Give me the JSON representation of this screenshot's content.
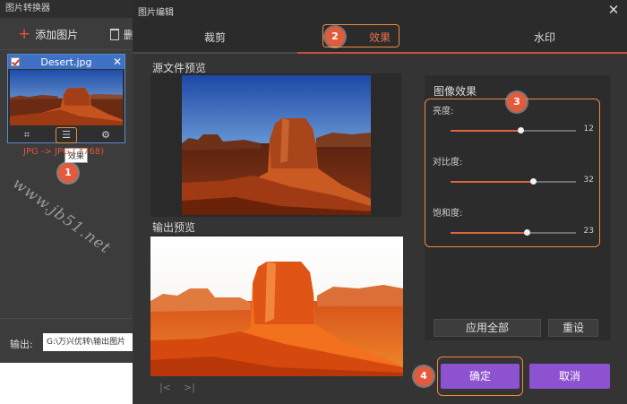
{
  "background_window": {
    "title": "图片转换器",
    "add_image_label": "添加图片",
    "delete_label": "删",
    "file": {
      "name": "Desert.jpg",
      "close_glyph": "✕",
      "format_text": "JPG -> JPG (   *768)"
    },
    "tooltip": "效果",
    "watermark": "www.jb51.net",
    "output_label": "输出:",
    "output_path": "G:\\万兴优转\\输出图片"
  },
  "dialog": {
    "title": "图片编辑",
    "close_glyph": "✕",
    "tabs": [
      {
        "label": "裁剪"
      },
      {
        "label": "效果",
        "selected": true
      },
      {
        "label": "水印"
      }
    ],
    "source_label": "源文件预览",
    "output_label": "输出预览",
    "nav_prev": "|<",
    "nav_next": ">|",
    "effects": {
      "title": "图像效果",
      "sliders": [
        {
          "label": "亮度:",
          "value": "12",
          "fraction": 0.56
        },
        {
          "label": "对比度:",
          "value": "32",
          "fraction": 0.66
        },
        {
          "label": "饱和度:",
          "value": "23",
          "fraction": 0.61
        }
      ],
      "apply_all": "应用全部",
      "reset": "重设"
    },
    "ok": "确定",
    "cancel": "取消"
  },
  "steps": [
    "1",
    "2",
    "3",
    "4"
  ],
  "colors": {
    "accent_orange": "#f08a3c",
    "primary_purple": "#8c52d0",
    "step_red": "#e25b3c"
  }
}
